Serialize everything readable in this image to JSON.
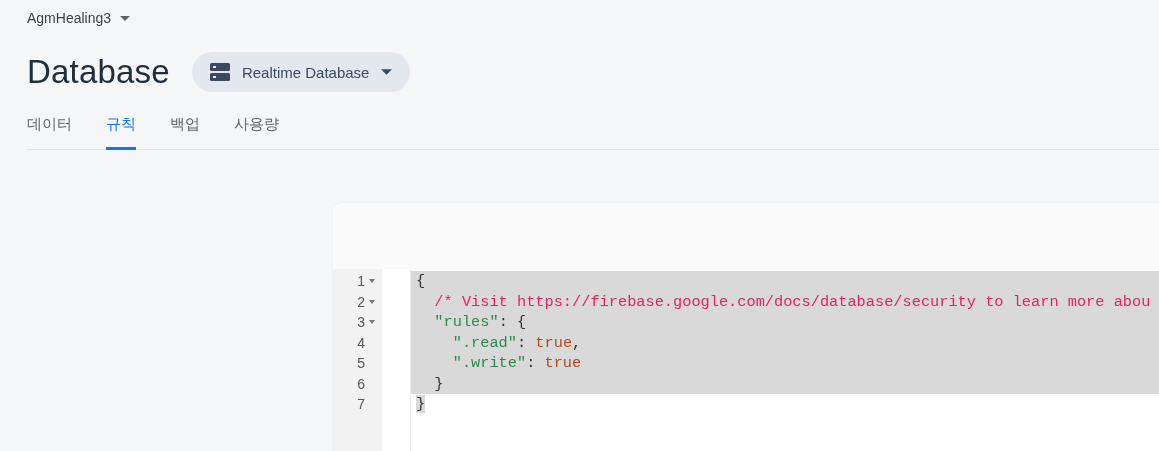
{
  "project": {
    "name": "AgmHealing3"
  },
  "page_title": "Database",
  "db_selector": {
    "label": "Realtime Database"
  },
  "tabs": [
    {
      "label": "데이터",
      "selected": false
    },
    {
      "label": "규칙",
      "selected": true
    },
    {
      "label": "백업",
      "selected": false
    },
    {
      "label": "사용량",
      "selected": false
    }
  ],
  "editor": {
    "lines": [
      {
        "number": "1",
        "foldable": true,
        "selected": true,
        "selection_end": false,
        "tokens": [
          {
            "kind": "punct",
            "text": "{"
          }
        ]
      },
      {
        "number": "2",
        "foldable": true,
        "selected": true,
        "selection_end": false,
        "tokens": [
          {
            "kind": "comment",
            "text": "  /* Visit https://firebase.google.com/docs/database/security to learn more abou"
          }
        ]
      },
      {
        "number": "3",
        "foldable": true,
        "selected": true,
        "selection_end": false,
        "tokens": [
          {
            "kind": "key",
            "text": "  \"rules\""
          },
          {
            "kind": "punct",
            "text": ": {"
          }
        ]
      },
      {
        "number": "4",
        "foldable": false,
        "selected": true,
        "selection_end": false,
        "tokens": [
          {
            "kind": "key",
            "text": "    \".read\""
          },
          {
            "kind": "punct",
            "text": ": "
          },
          {
            "kind": "bool",
            "text": "true"
          },
          {
            "kind": "punct",
            "text": ","
          }
        ]
      },
      {
        "number": "5",
        "foldable": false,
        "selected": true,
        "selection_end": false,
        "tokens": [
          {
            "kind": "key",
            "text": "    \".write\""
          },
          {
            "kind": "punct",
            "text": ": "
          },
          {
            "kind": "bool",
            "text": "true"
          }
        ]
      },
      {
        "number": "6",
        "foldable": false,
        "selected": true,
        "selection_end": false,
        "tokens": [
          {
            "kind": "punct",
            "text": "  }"
          }
        ]
      },
      {
        "number": "7",
        "foldable": false,
        "selected": true,
        "selection_end": true,
        "tokens": [
          {
            "kind": "punct",
            "text": "}"
          }
        ]
      }
    ]
  }
}
